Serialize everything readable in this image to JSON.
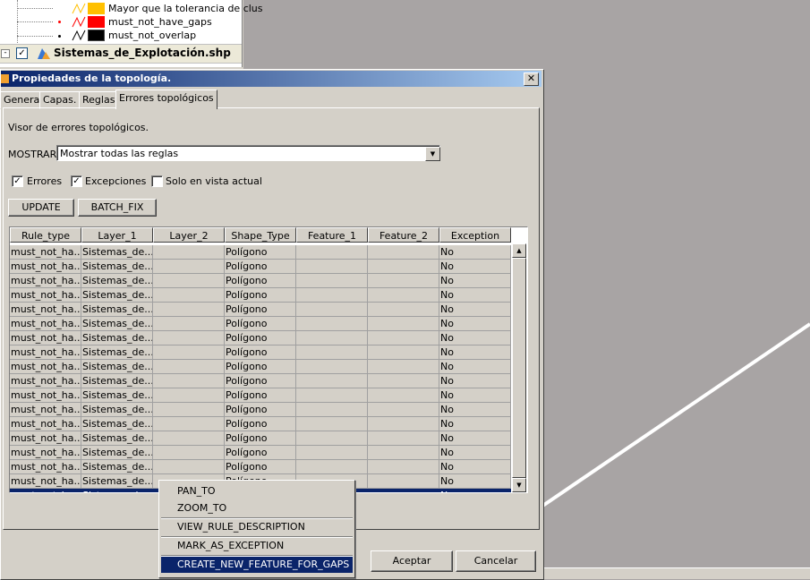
{
  "colors": {
    "title_gradient_start": "#0a246a",
    "selection": "#0a246a",
    "map_background": "#a8a4a4",
    "legend_orange": "#ffc000",
    "legend_red": "#ff0000",
    "legend_black": "#000000"
  },
  "legend": {
    "items": [
      {
        "label": "Mayor que la tolerancia de clus",
        "color": "#ffc000"
      },
      {
        "label": "must_not_have_gaps",
        "color": "#ff0000"
      },
      {
        "label": "must_not_overlap",
        "color": "#000000"
      }
    ],
    "layer_label": "Sistemas_de_Explotación.shp",
    "layer_checked": "✓"
  },
  "dialog": {
    "title": "Propiedades de la topología.",
    "close_glyph": "✕",
    "tabs": [
      "General",
      "Capas.",
      "Reglas",
      "Errores topológicos"
    ],
    "viewer_label": "Visor de errores topológicos.",
    "mostrar_label": "MOSTRAR",
    "mostrar_value": "Mostrar todas las reglas",
    "checkboxes": [
      {
        "label": "Errores",
        "checked": "✓"
      },
      {
        "label": "Excepciones",
        "checked": "✓"
      },
      {
        "label": "Solo en vista actual",
        "checked": ""
      }
    ],
    "update_label": "UPDATE",
    "batch_fix_label": "BATCH_FIX",
    "accept_label": "Aceptar",
    "cancel_label": "Cancelar"
  },
  "table": {
    "headers": [
      "Rule_type",
      "Layer_1",
      "Layer_2",
      "Shape_Type",
      "Feature_1",
      "Feature_2",
      "Exception"
    ],
    "rows": [
      [
        "must_not_ha...",
        "Sistemas_de...",
        "",
        "Polígono",
        "",
        "",
        "No"
      ],
      [
        "must_not_ha...",
        "Sistemas_de...",
        "",
        "Polígono",
        "",
        "",
        "No"
      ],
      [
        "must_not_ha...",
        "Sistemas_de...",
        "",
        "Polígono",
        "",
        "",
        "No"
      ],
      [
        "must_not_ha...",
        "Sistemas_de...",
        "",
        "Polígono",
        "",
        "",
        "No"
      ],
      [
        "must_not_ha...",
        "Sistemas_de...",
        "",
        "Polígono",
        "",
        "",
        "No"
      ],
      [
        "must_not_ha...",
        "Sistemas_de...",
        "",
        "Polígono",
        "",
        "",
        "No"
      ],
      [
        "must_not_ha...",
        "Sistemas_de...",
        "",
        "Polígono",
        "",
        "",
        "No"
      ],
      [
        "must_not_ha...",
        "Sistemas_de...",
        "",
        "Polígono",
        "",
        "",
        "No"
      ],
      [
        "must_not_ha...",
        "Sistemas_de...",
        "",
        "Polígono",
        "",
        "",
        "No"
      ],
      [
        "must_not_ha...",
        "Sistemas_de...",
        "",
        "Polígono",
        "",
        "",
        "No"
      ],
      [
        "must_not_ha...",
        "Sistemas_de...",
        "",
        "Polígono",
        "",
        "",
        "No"
      ],
      [
        "must_not_ha...",
        "Sistemas_de...",
        "",
        "Polígono",
        "",
        "",
        "No"
      ],
      [
        "must_not_ha...",
        "Sistemas_de...",
        "",
        "Polígono",
        "",
        "",
        "No"
      ],
      [
        "must_not_ha...",
        "Sistemas_de...",
        "",
        "Polígono",
        "",
        "",
        "No"
      ],
      [
        "must_not_ha...",
        "Sistemas_de...",
        "",
        "Polígono",
        "",
        "",
        "No"
      ],
      [
        "must_not_ha...",
        "Sistemas_de...",
        "",
        "Polígono",
        "",
        "",
        "No"
      ],
      [
        "must_not_ha...",
        "Sistemas_de...",
        "",
        "Polígono",
        "",
        "",
        "No"
      ]
    ],
    "selected_row": [
      "must_not_ha...",
      "Sistemas_de...",
      "",
      "Polígono",
      "",
      "",
      "No"
    ],
    "scroll_up_glyph": "▲",
    "scroll_down_glyph": "▼"
  },
  "context_menu": {
    "items": [
      "PAN_TO",
      "ZOOM_TO",
      "VIEW_RULE_DESCRIPTION",
      "MARK_AS_EXCEPTION",
      "CREATE_NEW_FEATURE_FOR_GAPS"
    ],
    "highlighted": "CREATE_NEW_FEATURE_FOR_GAPS"
  },
  "icons": {
    "tree_expand": "minus-box-icon",
    "layer_icon": "shapefile-layer-icon",
    "title_icon": "topology-icon",
    "dropdown": "chevron-down-icon"
  }
}
